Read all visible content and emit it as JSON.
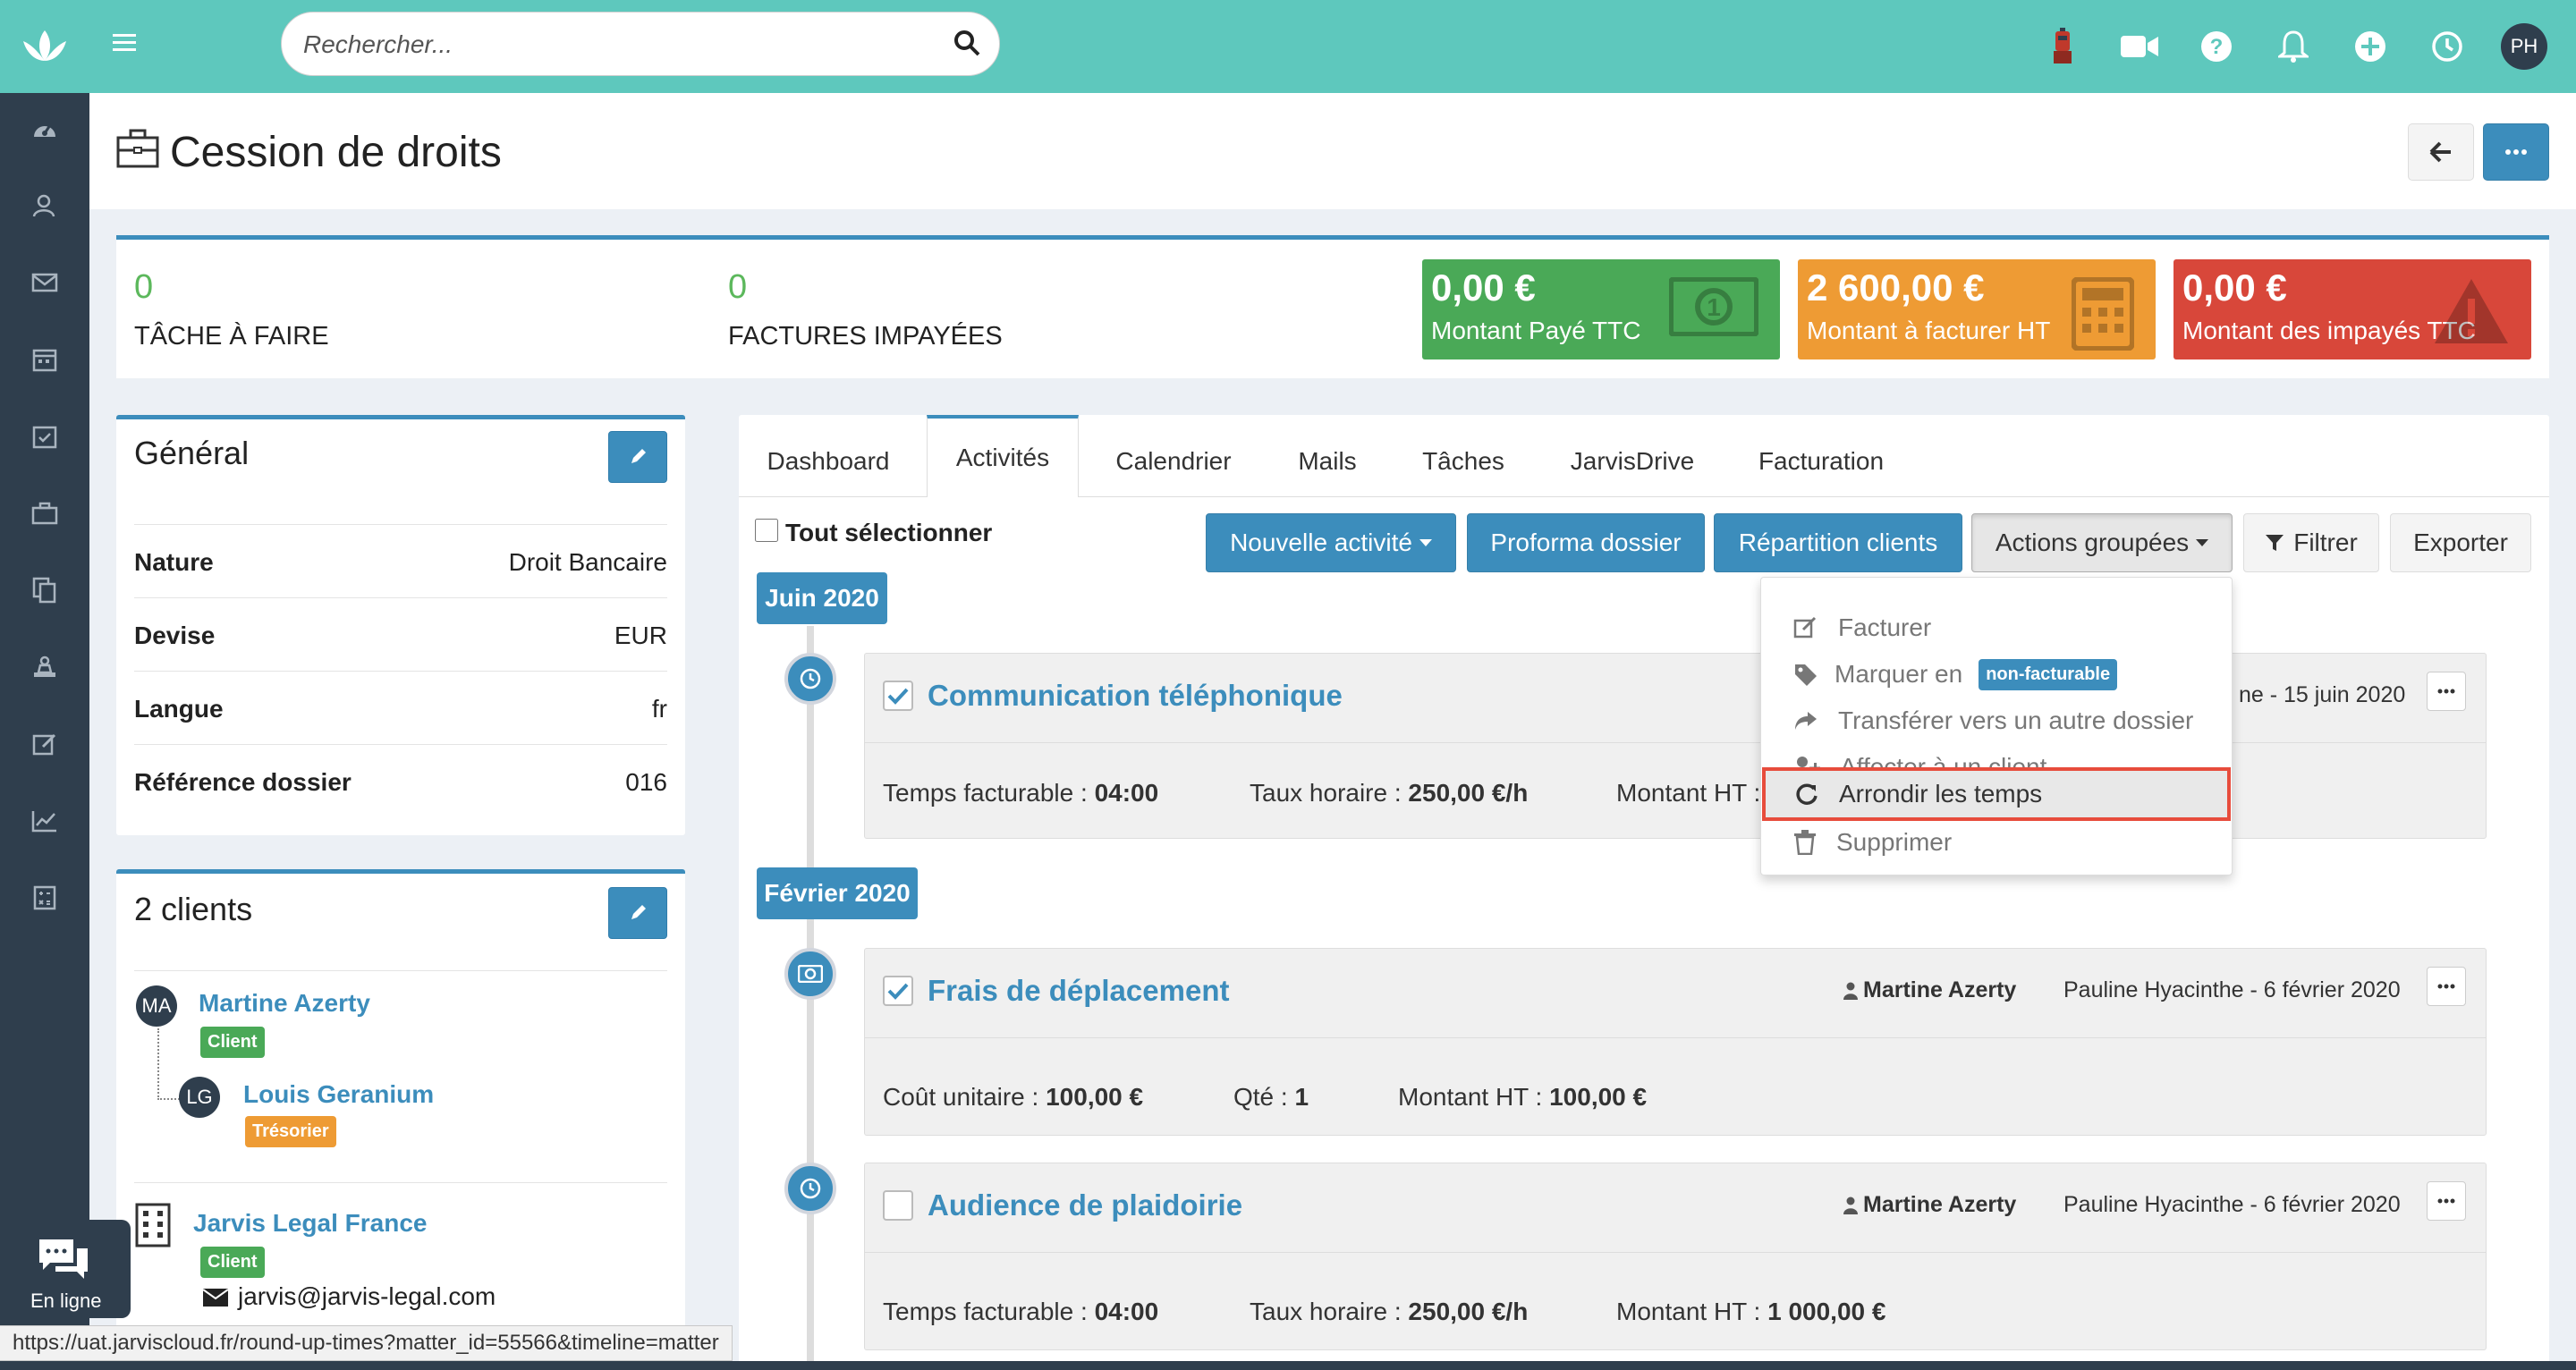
{
  "topbar": {
    "search_placeholder": "Rechercher...",
    "avatar_initials": "PH"
  },
  "page": {
    "title": "Cession de droits"
  },
  "stats": {
    "tasks_value": "0",
    "tasks_label": "TÂCHE À FAIRE",
    "invoices_value": "0",
    "invoices_label": "FACTURES IMPAYÉES",
    "paid_amount": "0,00 €",
    "paid_label": "Montant Payé TTC",
    "paid_color": "#4aa957",
    "tobill_amount": "2 600,00 €",
    "tobill_label": "Montant à facturer HT",
    "tobill_color": "#ee9b34",
    "unpaid_amount": "0,00 €",
    "unpaid_label": "Montant des impayés TTC",
    "unpaid_color": "#d8473a"
  },
  "general": {
    "title": "Général",
    "rows": [
      {
        "key": "Nature",
        "value": "Droit Bancaire"
      },
      {
        "key": "Devise",
        "value": "EUR"
      },
      {
        "key": "Langue",
        "value": "fr"
      },
      {
        "key": "Référence dossier",
        "value": "016"
      }
    ]
  },
  "clients": {
    "title": "2 clients",
    "items": [
      {
        "initials": "MA",
        "name": "Martine Azerty",
        "badge": "Client"
      },
      {
        "initials": "LG",
        "name": "Louis Geranium",
        "badge": "Trésorier"
      }
    ],
    "company": {
      "name": "Jarvis Legal France",
      "badge": "Client",
      "email": "jarvis@jarvis-legal.com"
    }
  },
  "tabs": [
    "Dashboard",
    "Activités",
    "Calendrier",
    "Mails",
    "Tâches",
    "JarvisDrive",
    "Facturation"
  ],
  "toolbar": {
    "select_all": "Tout sélectionner",
    "new_activity": "Nouvelle activité",
    "proforma": "Proforma dossier",
    "repartition": "Répartition clients",
    "grouped_actions": "Actions groupées",
    "filter": "Filtrer",
    "export": "Exporter"
  },
  "dropdown": {
    "items": [
      "Facturer",
      "Marquer en",
      "Transférer vers un autre dossier",
      "Affecter à un client",
      "Arrondir les temps",
      "Supprimer"
    ],
    "badge": "non-facturable"
  },
  "timeline": {
    "months": [
      "Juin 2020",
      "Février 2020"
    ],
    "activities": [
      {
        "title": "Communication téléphonique",
        "meta": "ne - 15 juin 2020",
        "f1_label": "Temps facturable : ",
        "f1_value": "04:00",
        "f2_label": "Taux horaire : ",
        "f2_value": "250,00 €/h",
        "f3_label": "Montant HT :",
        "f3_value": ""
      },
      {
        "title": "Frais de déplacement",
        "who": "Martine Azerty",
        "meta": "Pauline Hyacinthe - 6 février 2020",
        "f1_label": "Coût unitaire : ",
        "f1_value": "100,00 €",
        "f2_label": "Qté : ",
        "f2_value": "1",
        "f3_label": "Montant HT : ",
        "f3_value": "100,00 €"
      },
      {
        "title": "Audience de plaidoirie",
        "who": "Martine Azerty",
        "meta": "Pauline Hyacinthe - 6 février 2020",
        "f1_label": "Temps facturable : ",
        "f1_value": "04:00",
        "f2_label": "Taux horaire : ",
        "f2_value": "250,00 €/h",
        "f3_label": "Montant HT : ",
        "f3_value": "1 000,00 €"
      }
    ]
  },
  "chat": {
    "label": "En ligne"
  },
  "statusbar": {
    "url": "https://uat.jarviscloud.fr/round-up-times?matter_id=55566&timeline=matter"
  }
}
